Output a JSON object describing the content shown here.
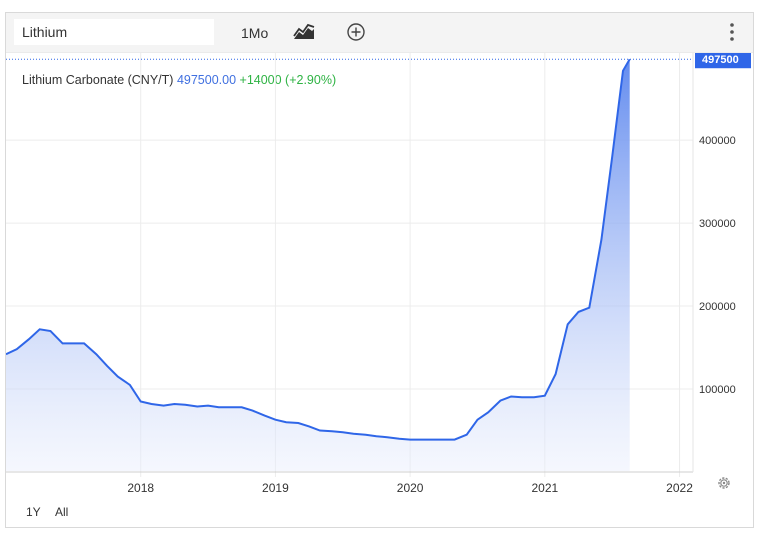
{
  "toolbar": {
    "search_value": "Lithium",
    "period_label": "1Mo",
    "chart_type_icon": "area-chart-icon",
    "compare_icon": "add-circle-icon",
    "menu_icon": "more-vertical-icon"
  },
  "legend": {
    "name": "Lithium Carbonate (CNY/T)",
    "price": "497500.00",
    "change": "+14000 (+2.90%)"
  },
  "range_buttons": [
    "1Y",
    "All"
  ],
  "settings_icon": "gear-icon",
  "colors": {
    "line": "#2f66e8",
    "price_label_bg": "#2f66e8",
    "change": "#2fb344",
    "fill_top": "#6f95f0"
  },
  "chart_data": {
    "type": "area",
    "title": "",
    "xlabel": "",
    "ylabel": "",
    "x_ticks": [
      "2018",
      "2019",
      "2020",
      "2021",
      "2022"
    ],
    "y_ticks": [
      "100000",
      "200000",
      "300000",
      "400000"
    ],
    "last_value_label": "497500",
    "xlim": [
      2017.0,
      2022.1
    ],
    "ylim": [
      0,
      505000
    ],
    "grid": true,
    "series": [
      {
        "points": [
          [
            2017.0,
            142000
          ],
          [
            2017.08,
            148000
          ],
          [
            2017.17,
            160000
          ],
          [
            2017.25,
            172000
          ],
          [
            2017.33,
            170000
          ],
          [
            2017.42,
            155000
          ],
          [
            2017.5,
            155000
          ],
          [
            2017.58,
            155000
          ],
          [
            2017.67,
            142000
          ],
          [
            2017.75,
            128000
          ],
          [
            2017.83,
            115000
          ],
          [
            2017.92,
            105000
          ],
          [
            2018.0,
            85000
          ],
          [
            2018.08,
            82000
          ],
          [
            2018.17,
            80000
          ],
          [
            2018.25,
            82000
          ],
          [
            2018.33,
            81000
          ],
          [
            2018.42,
            79000
          ],
          [
            2018.5,
            80000
          ],
          [
            2018.58,
            78000
          ],
          [
            2018.67,
            78000
          ],
          [
            2018.75,
            78000
          ],
          [
            2018.83,
            74000
          ],
          [
            2018.92,
            68000
          ],
          [
            2019.0,
            63000
          ],
          [
            2019.08,
            60000
          ],
          [
            2019.17,
            59000
          ],
          [
            2019.25,
            55000
          ],
          [
            2019.33,
            50000
          ],
          [
            2019.42,
            49000
          ],
          [
            2019.5,
            48000
          ],
          [
            2019.58,
            46000
          ],
          [
            2019.67,
            45000
          ],
          [
            2019.75,
            43000
          ],
          [
            2019.83,
            42000
          ],
          [
            2019.92,
            40000
          ],
          [
            2020.0,
            39000
          ],
          [
            2020.08,
            39000
          ],
          [
            2020.17,
            39000
          ],
          [
            2020.25,
            39000
          ],
          [
            2020.33,
            39000
          ],
          [
            2020.42,
            45000
          ],
          [
            2020.5,
            63000
          ],
          [
            2020.58,
            72000
          ],
          [
            2020.67,
            86000
          ],
          [
            2020.75,
            91000
          ],
          [
            2020.83,
            90000
          ],
          [
            2020.92,
            90000
          ],
          [
            2021.0,
            92000
          ],
          [
            2021.08,
            118000
          ],
          [
            2021.17,
            178000
          ],
          [
            2021.25,
            193000
          ],
          [
            2021.33,
            198000
          ],
          [
            2021.42,
            280000
          ],
          [
            2021.5,
            380000
          ],
          [
            2021.58,
            483500
          ],
          [
            2021.63,
            497500
          ]
        ]
      }
    ]
  }
}
